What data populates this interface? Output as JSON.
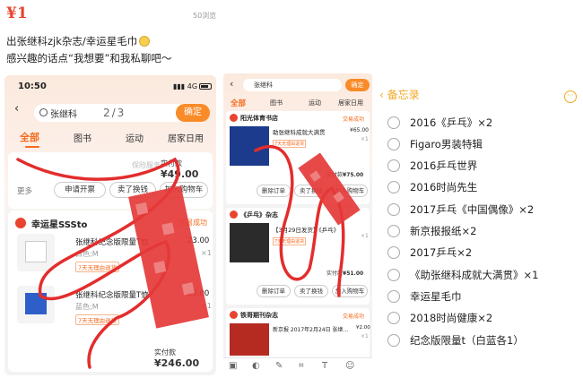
{
  "post": {
    "user_tag": "¥1",
    "user_sub": "¥1",
    "views": "50浏览",
    "line1": "出张继科zjk杂志/幸运星毛巾",
    "line2": "感兴趣的话点“我想要”和我私聊吧～"
  },
  "phone1": {
    "time": "10:50",
    "network": "4G",
    "search_query": "张继科",
    "match_counter": "2/3",
    "confirm_label": "确定",
    "tabs": [
      "全部",
      "图书",
      "运动",
      "居家日用"
    ],
    "order1": {
      "faded_service": "保险服务",
      "paid_label": "实付款",
      "paid_value": "¥49.00",
      "more": "更多",
      "buttons": [
        "申请开票",
        "卖了换钱",
        "加入购物车"
      ]
    },
    "order2": {
      "shop_name": "幸运星SSSto",
      "status": "交易成功",
      "items": [
        {
          "title": "张继科纪念版限量T恤",
          "variant": "白色;M",
          "tag": "7天无理由退货",
          "price": "23.00",
          "qty": "×1"
        },
        {
          "title": "张继科纪念版限量T恤",
          "variant": "蓝色;M",
          "tag": "7天无理由退货",
          "price": "23.00",
          "qty": "×1"
        }
      ],
      "paid_label": "实付款",
      "paid_value": "¥246.00"
    }
  },
  "phone2": {
    "search_query": "张继科",
    "confirm_label": "确定",
    "tabs": [
      "全部",
      "图书",
      "运动",
      "居家日用"
    ],
    "order1": {
      "shop": "阳光体育书店",
      "status": "交易成功",
      "title": "助张继科成就大满贯",
      "price": "¥65.00",
      "qty": "×1",
      "tag": "7天无理由退货",
      "paid_label": "实付款",
      "paid_value": "¥75.00",
      "buttons": [
        "删除订单",
        "卖了换钱",
        "加入购物车"
      ]
    },
    "order2": {
      "shop": "《乒乓》杂志",
      "title": "【3月29日发货】《乒乓》",
      "qty": "×1",
      "tag": "7天无理由退货",
      "paid_label": "实付款",
      "paid_value": "¥51.00",
      "buttons": [
        "删除订单",
        "卖了换钱",
        "加入购物车"
      ]
    },
    "order3": {
      "shop": "铁哥期刊杂志",
      "status": "交易成功",
      "title": "新京报 2017年2月24日 张继…",
      "price": "¥2.00",
      "qty": "×1"
    }
  },
  "memo": {
    "back_label": "备忘录",
    "items": [
      "2016《乒乓》×2",
      "Figaro男装特辑",
      "2016乒乓世界",
      "2016时尚先生",
      "2017乒乓《中国偶像》×2",
      "新京报报纸×2",
      "2017乒乓×2",
      "《助张继科成就大满贯》×1",
      "幸运星毛巾",
      "2018时尚健康×2",
      "纪念版限量t（白蓝各1）"
    ]
  }
}
